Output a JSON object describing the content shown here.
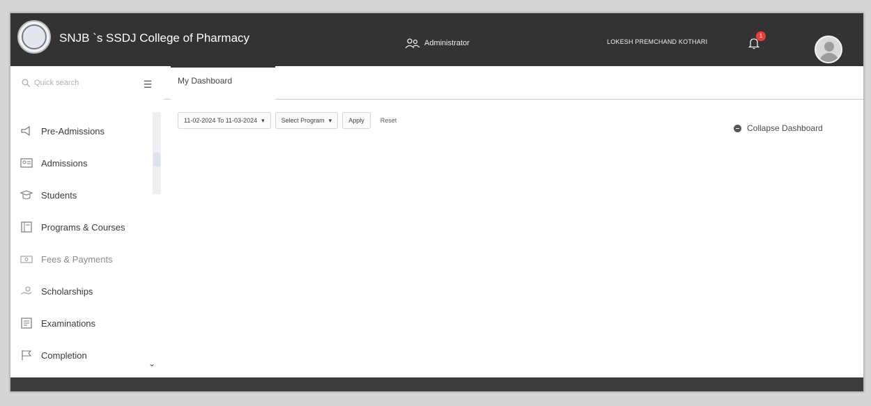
{
  "header": {
    "college_name": "SNJB `s SSDJ College of Pharmacy",
    "role": "Administrator",
    "user_name": "LOKESH PREMCHAND KOTHARI",
    "notification_count": "1",
    "logo_icon": "college-seal",
    "bg_color": "#333333"
  },
  "sidebar": {
    "search_placeholder": "Quick search",
    "items": [
      {
        "label": "Pre-Admissions",
        "icon": "megaphone-icon"
      },
      {
        "label": "Admissions",
        "icon": "id-card-icon"
      },
      {
        "label": "Students",
        "icon": "graduate-icon"
      },
      {
        "label": "Programs & Courses",
        "icon": "book-icon"
      },
      {
        "label": "Fees & Payments",
        "icon": "money-icon"
      },
      {
        "label": "Scholarships",
        "icon": "hand-coin-icon"
      },
      {
        "label": "Examinations",
        "icon": "exam-icon"
      },
      {
        "label": "Completion",
        "icon": "flag-icon"
      }
    ]
  },
  "tabs": [
    {
      "label": "My Dashboard",
      "active": true
    }
  ],
  "filters": {
    "date_range": "11-02-2024 To 11-03-2024",
    "program_placeholder": "Select Program",
    "apply_label": "Apply",
    "reset_label": "Reset"
  },
  "dashboard": {
    "collapse_label": "Collapse Dashboard"
  },
  "footer": {
    "left_text": "",
    "right_text": ""
  }
}
